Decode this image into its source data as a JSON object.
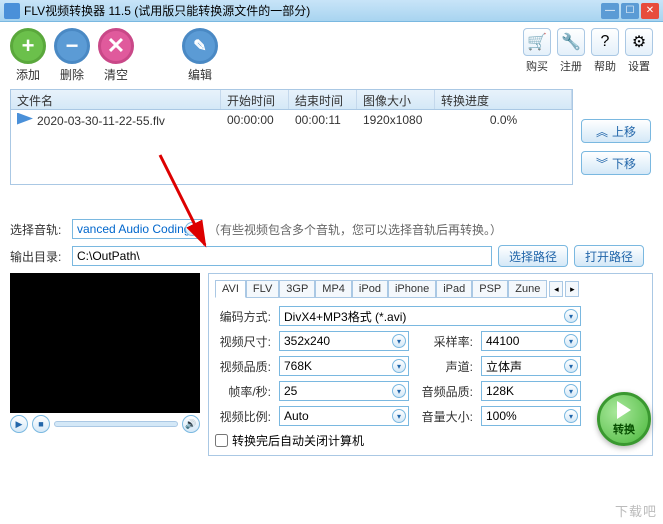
{
  "window": {
    "title": "FLV视频转换器 11.5 (试用版只能转换源文件的一部分)"
  },
  "toolbar": {
    "add": "添加",
    "del": "删除",
    "clr": "清空",
    "edit": "编辑",
    "buy": "购买",
    "reg": "注册",
    "help": "帮助",
    "set": "设置"
  },
  "table": {
    "cols": {
      "name": "文件名",
      "start": "开始时间",
      "end": "结束时间",
      "size": "图像大小",
      "progress": "转换进度"
    },
    "rows": [
      {
        "name": "2020-03-30-11-22-55.flv",
        "start": "00:00:00",
        "end": "00:00:11",
        "size": "1920x1080",
        "progress": "0.0%"
      }
    ]
  },
  "side": {
    "up": "上移",
    "down": "下移"
  },
  "track": {
    "label": "选择音轨:",
    "value": "vanced Audio Coding)",
    "hint": "（有些视频包含多个音轨，您可以选择音轨后再转换。）"
  },
  "output": {
    "label": "输出目录:",
    "path": "C:\\OutPath\\",
    "choose": "选择路径",
    "open": "打开路径"
  },
  "formats": [
    "AVI",
    "FLV",
    "3GP",
    "MP4",
    "iPod",
    "iPhone",
    "iPad",
    "PSP",
    "Zune"
  ],
  "settings": {
    "encode_label": "编码方式:",
    "encode": "DivX4+MP3格式 (*.avi)",
    "vsize_label": "视频尺寸:",
    "vsize": "352x240",
    "srate_label": "采样率:",
    "srate": "44100",
    "vqual_label": "视频品质:",
    "vqual": "768K",
    "chan_label": "声道:",
    "chan": "立体声",
    "fps_label": "帧率/秒:",
    "fps": "25",
    "aqual_label": "音频品质:",
    "aqual": "128K",
    "ratio_label": "视频比例:",
    "ratio": "Auto",
    "vol_label": "音量大小:",
    "vol": "100%",
    "shutdown": "转换完后自动关闭计算机"
  },
  "convert": "转换",
  "watermark": "下载吧"
}
